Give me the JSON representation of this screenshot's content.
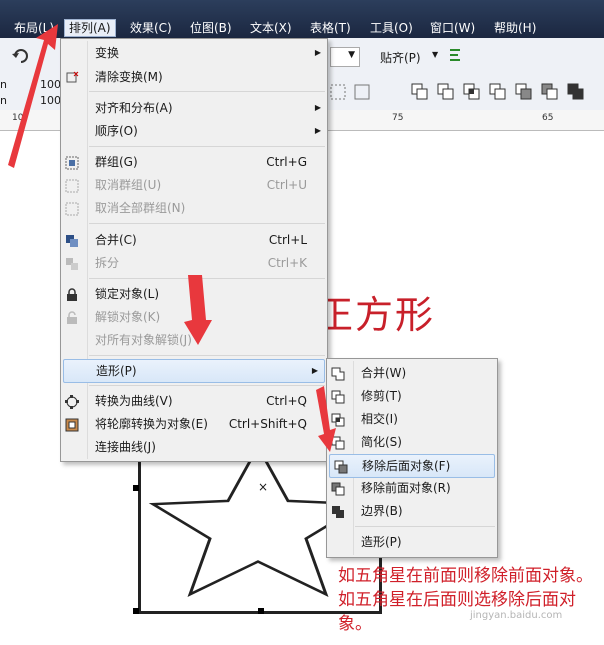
{
  "menubar": {
    "items": [
      "布局(L)",
      "排列(A)",
      "效果(C)",
      "位图(B)",
      "文本(X)",
      "表格(T)",
      "工具(O)",
      "窗口(W)",
      "帮助(H)"
    ]
  },
  "propbar": {
    "snap_label": "贴齐(P)",
    "field1": "100",
    "field2": "100",
    "unit1": "n",
    "unit2": "n"
  },
  "ruler": {
    "labels": [
      "10",
      "75",
      "65"
    ]
  },
  "arrange_menu": {
    "items": [
      {
        "label": "变换",
        "shortcut": "",
        "submenu": true
      },
      {
        "label": "清除变换(M)",
        "shortcut": ""
      },
      {
        "label": "对齐和分布(A)",
        "shortcut": "",
        "submenu": true
      },
      {
        "label": "顺序(O)",
        "shortcut": "",
        "submenu": true
      },
      {
        "label": "群组(G)",
        "shortcut": "Ctrl+G"
      },
      {
        "label": "取消群组(U)",
        "shortcut": "Ctrl+U"
      },
      {
        "label": "取消全部群组(N)",
        "shortcut": ""
      },
      {
        "label": "合并(C)",
        "shortcut": "Ctrl+L"
      },
      {
        "label": "拆分",
        "shortcut": "Ctrl+K"
      },
      {
        "label": "锁定对象(L)",
        "shortcut": ""
      },
      {
        "label": "解锁对象(K)",
        "shortcut": ""
      },
      {
        "label": "对所有对象解锁(J)",
        "shortcut": ""
      },
      {
        "label": "造形(P)",
        "shortcut": "",
        "submenu": true
      },
      {
        "label": "转换为曲线(V)",
        "shortcut": "Ctrl+Q"
      },
      {
        "label": "将轮廓转换为对象(E)",
        "shortcut": "Ctrl+Shift+Q"
      },
      {
        "label": "连接曲线(J)",
        "shortcut": ""
      }
    ]
  },
  "shaping_submenu": {
    "items": [
      "合并(W)",
      "修剪(T)",
      "相交(I)",
      "简化(S)",
      "移除后面对象(F)",
      "移除前面对象(R)",
      "边界(B)",
      "造形(P)"
    ]
  },
  "canvas": {
    "big_text": "正方形",
    "note": "如五角星在前面则移除前面对象。如五角星在后面则选移除后面对象。",
    "watermark": "jingyan.baidu.com"
  },
  "colors": {
    "accent_red": "#d0202a",
    "menubar_bg": "#1b2740",
    "highlight": "#d8e7f8"
  }
}
